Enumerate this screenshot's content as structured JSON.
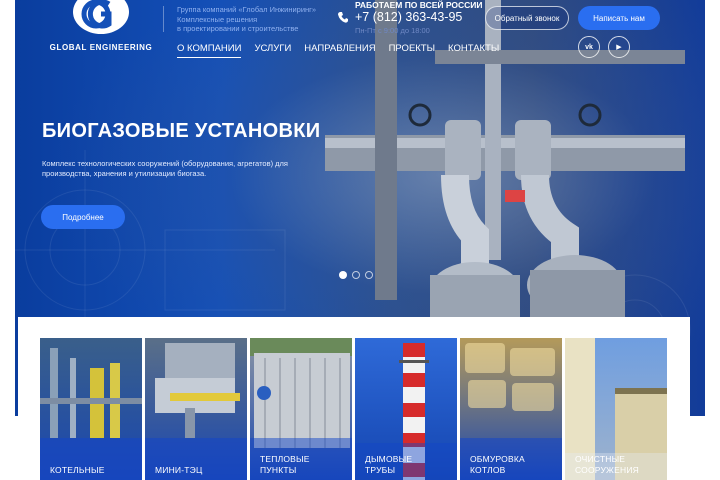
{
  "header": {
    "logo_text": "GLOBAL ENGINEERING",
    "tagline": [
      "Группа компаний «Глобал Инжиниринг»",
      "Комплексные решения",
      "в проектировании и строительстве"
    ],
    "contact_title": "РАБОТАЕМ ПО ВСЕЙ РОССИИ",
    "phone": "+7 (812) 363-43-95",
    "hours": "Пн-Пт с 9:00 до 18:00",
    "callback_label": "Обратный звонок",
    "write_label": "Написать нам",
    "social": [
      {
        "name": "vk",
        "icon": "vk-icon",
        "glyph": "vk"
      },
      {
        "name": "youtube",
        "icon": "youtube-icon",
        "glyph": "▶"
      }
    ]
  },
  "nav": {
    "items": [
      "О КОМПАНИИ",
      "УСЛУГИ",
      "НАПРАВЛЕНИЯ",
      "ПРОЕКТЫ",
      "КОНТАКТЫ"
    ],
    "active": 0
  },
  "hero": {
    "headline": "БИОГАЗОВЫЕ УСТАНОВКИ",
    "description": "Комплекс технологических сооружений (оборудования, агрегатов) для производства, хранения и утилизации биогаза.",
    "more_label": "Подробнее",
    "slides_count": 3,
    "active_slide": 0
  },
  "cards": [
    {
      "lines": [
        "КОТЕЛЬНЫЕ"
      ]
    },
    {
      "lines": [
        "МИНИ-ТЭЦ"
      ]
    },
    {
      "lines": [
        "ТЕПЛОВЫЕ",
        "ПУНКТЫ"
      ]
    },
    {
      "lines": [
        "ДЫМОВЫЕ",
        "ТРУБЫ"
      ]
    },
    {
      "lines": [
        "ОБМУРОВКА",
        "КОТЛОВ"
      ]
    },
    {
      "lines": [
        "ОЧИСТНЫЕ",
        "СООРУЖЕНИЯ"
      ]
    }
  ],
  "colors": {
    "accent": "#2a6ef0",
    "hero_blue": "#1450b8",
    "tagline": "#8fb0ef"
  }
}
